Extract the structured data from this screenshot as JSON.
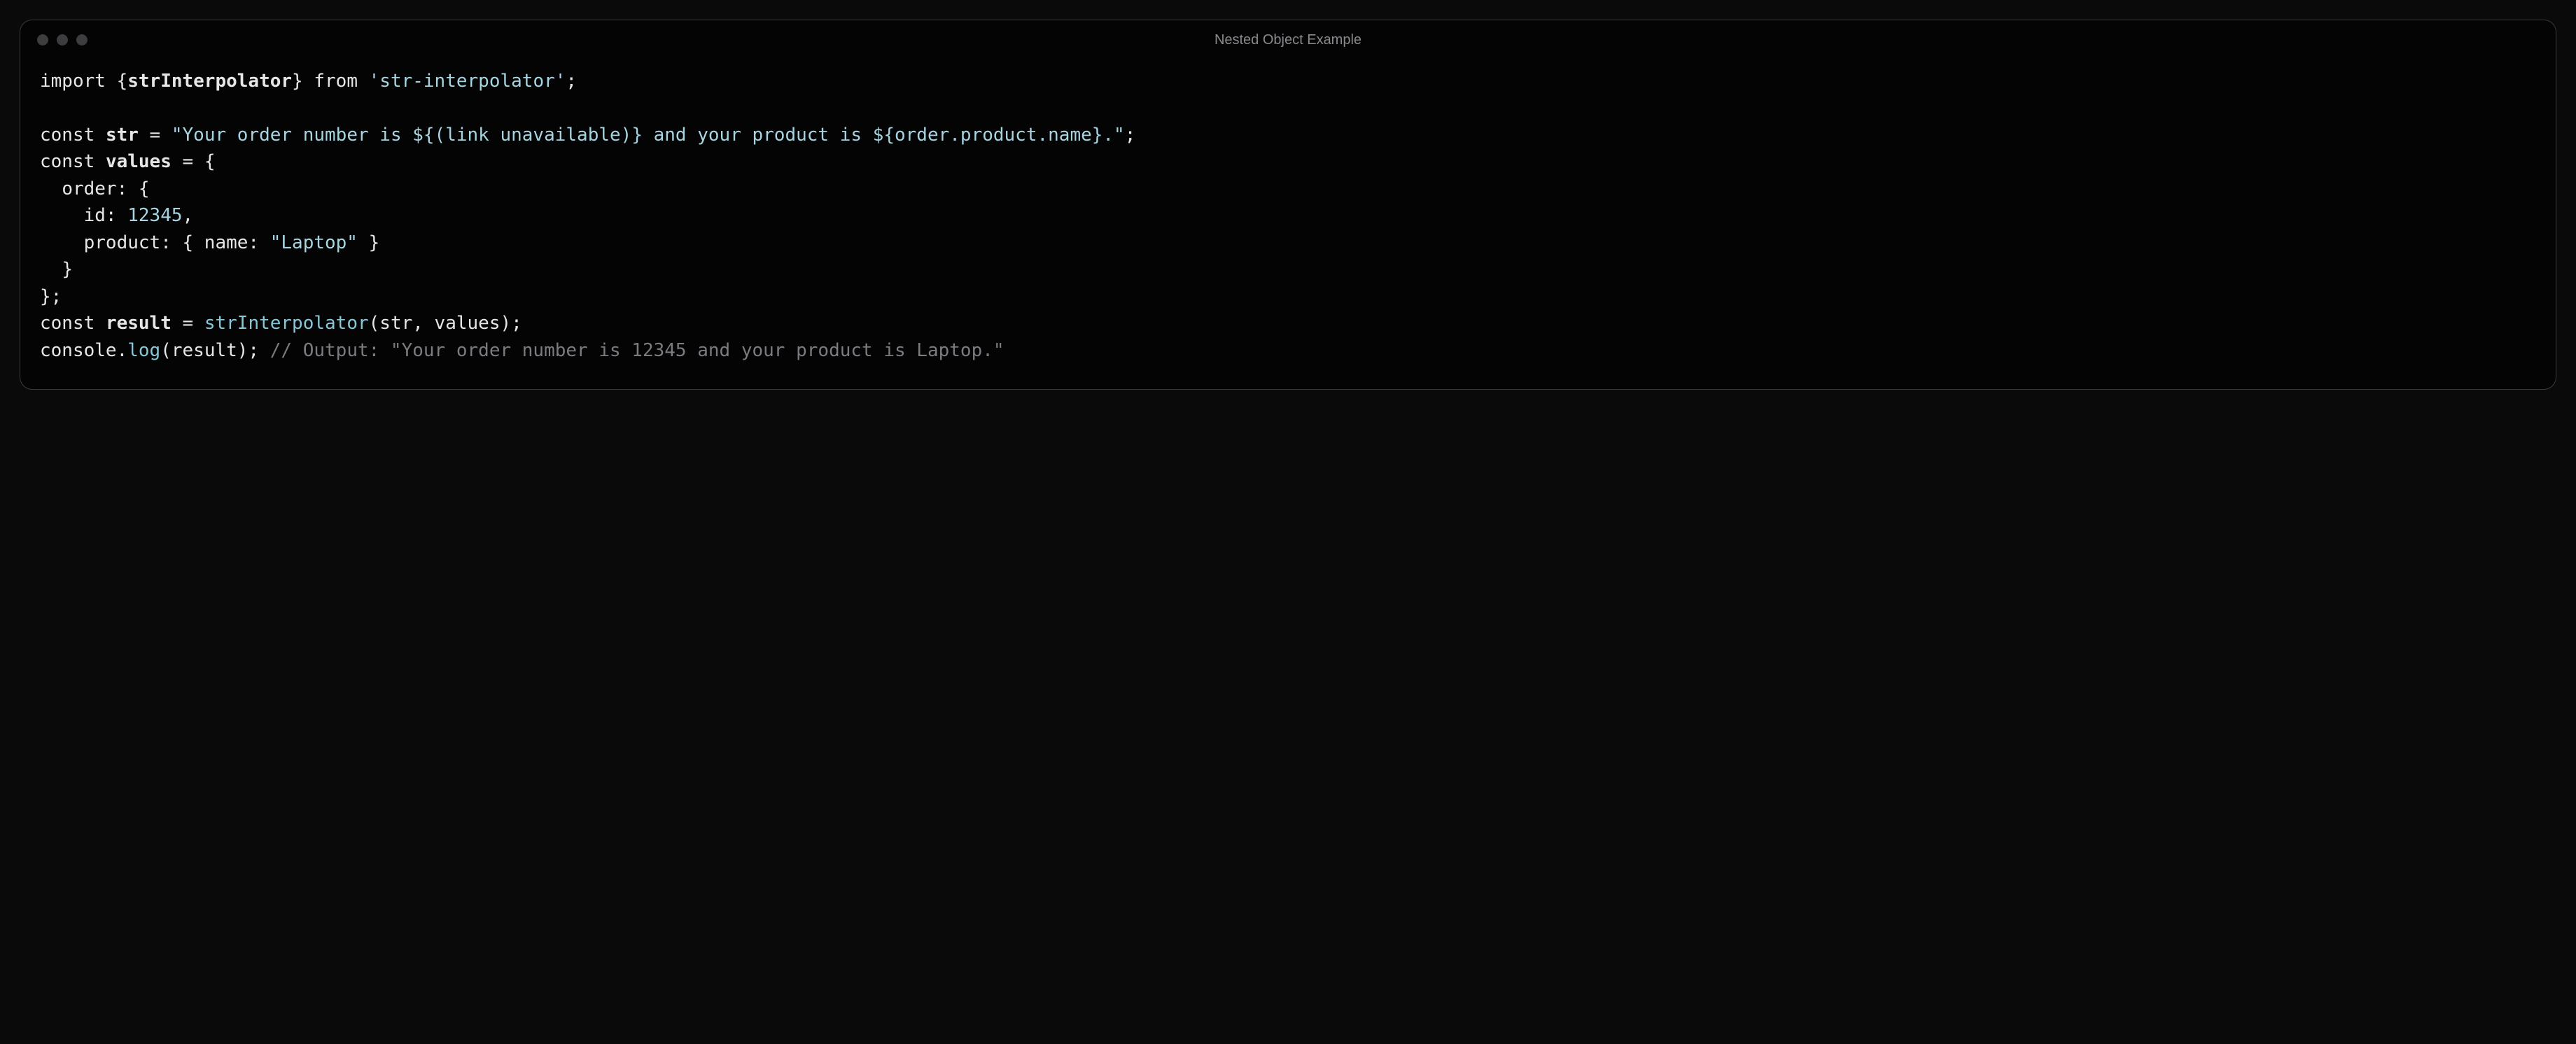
{
  "window": {
    "title": "Nested Object Example"
  },
  "code": {
    "l1_import": "import",
    "l1_braces_open": " {",
    "l1_identifier": "strInterpolator",
    "l1_braces_close": "} ",
    "l1_from": "from",
    "l1_space": " ",
    "l1_module": "'str-interpolator'",
    "l1_semi": ";",
    "blank": "",
    "l3_const": "const",
    "l3_sp": " ",
    "l3_var": "str",
    "l3_eq": " = ",
    "l3_string": "\"Your order number is ${(link unavailable)} and your product is ${order.product.name}.\"",
    "l3_semi": ";",
    "l4_const": "const",
    "l4_sp": " ",
    "l4_var": "values",
    "l4_eq": " = {",
    "l5": "  order: {",
    "l6_indent": "    id: ",
    "l6_num": "12345",
    "l6_comma": ",",
    "l7_a": "    product: { name: ",
    "l7_str": "\"Laptop\"",
    "l7_b": " }",
    "l8": "  }",
    "l9": "};",
    "l10_const": "const",
    "l10_sp": " ",
    "l10_var": "result",
    "l10_eq": " = ",
    "l10_fn": "strInterpolator",
    "l10_args": "(str, values);",
    "l11_console": "console",
    "l11_dot": ".",
    "l11_log": "log",
    "l11_args": "(result); ",
    "l11_comment": "// Output: \"Your order number is 12345 and your product is Laptop.\""
  }
}
